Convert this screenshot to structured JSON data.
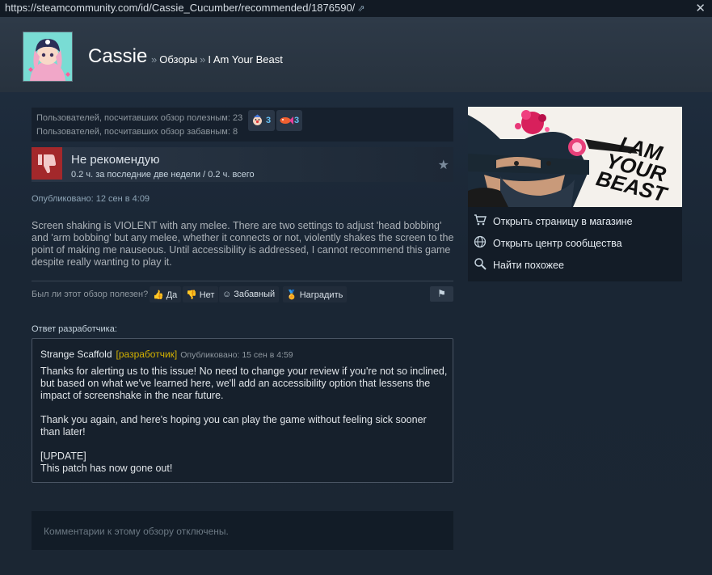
{
  "browser": {
    "url": "https://steamcommunity.com/id/Cassie_Cucumber/recommended/1876590/",
    "external_icon": "external-link-icon",
    "close_icon": "close-icon"
  },
  "profile": {
    "persona_name": "Cassie",
    "breadcrumb": {
      "separator": "»",
      "reviews": "Обзоры",
      "game": "I Am Your Beast"
    }
  },
  "ratings": {
    "helpful_text": "Пользователей, посчитавших обзор полезным: 23",
    "funny_text": "Пользователей, посчитавших обзор забавным: 8",
    "awards": [
      {
        "icon": "clown-award-icon",
        "count": "3"
      },
      {
        "icon": "fish-award-icon",
        "count": "3"
      }
    ]
  },
  "review": {
    "verdict": "Не рекомендую",
    "hours": "0.2 ч. за последние две недели / 0.2 ч. всего",
    "posted": "Опубликовано: 12 сен в 4:09",
    "text": "Screen shaking is VIOLENT with any melee. There are two settings to adjust 'head bobbing' and 'arm bobbing' but any melee, whether it connects or not, violently shakes the screen to the point of making me nauseous. Until accessibility is addressed, I cannot recommend this game despite really wanting to play it.",
    "verdict_color": "#a3282b"
  },
  "controls": {
    "question": "Был ли этот обзор полезен?",
    "yes": "Да",
    "no": "Нет",
    "funny": "Забавный",
    "award": "Наградить"
  },
  "developer": {
    "label": "Ответ разработчика:",
    "name": "Strange Scaffold",
    "tag": "[разработчик]",
    "date": "Опубликовано: 15 сен в 4:59",
    "paragraphs": [
      "Thanks for alerting us to this issue! No need to change your review if you're not so inclined, but based on what we've learned here, we'll add an accessibility option that lessens the impact of screenshake in the near future.",
      "Thank you again, and here's hoping you can play the game without feeling sick sooner than later!",
      "[UPDATE]\nThis patch has now gone out!"
    ]
  },
  "comments": {
    "disabled_text": "Комментарии к этому обзору отключены."
  },
  "sidebar": {
    "capsule_title_lines": [
      "I AM",
      "YOUR",
      "BEAST"
    ],
    "links": [
      {
        "icon": "cart-icon",
        "label": "Открыть страницу в магазине"
      },
      {
        "icon": "globe-icon",
        "label": "Открыть центр сообщества"
      },
      {
        "icon": "search-icon",
        "label": "Найти похожее"
      }
    ]
  },
  "colors": {
    "background": "#1b2838",
    "link": "#66c0f4",
    "developer_tag": "#d4b200"
  }
}
